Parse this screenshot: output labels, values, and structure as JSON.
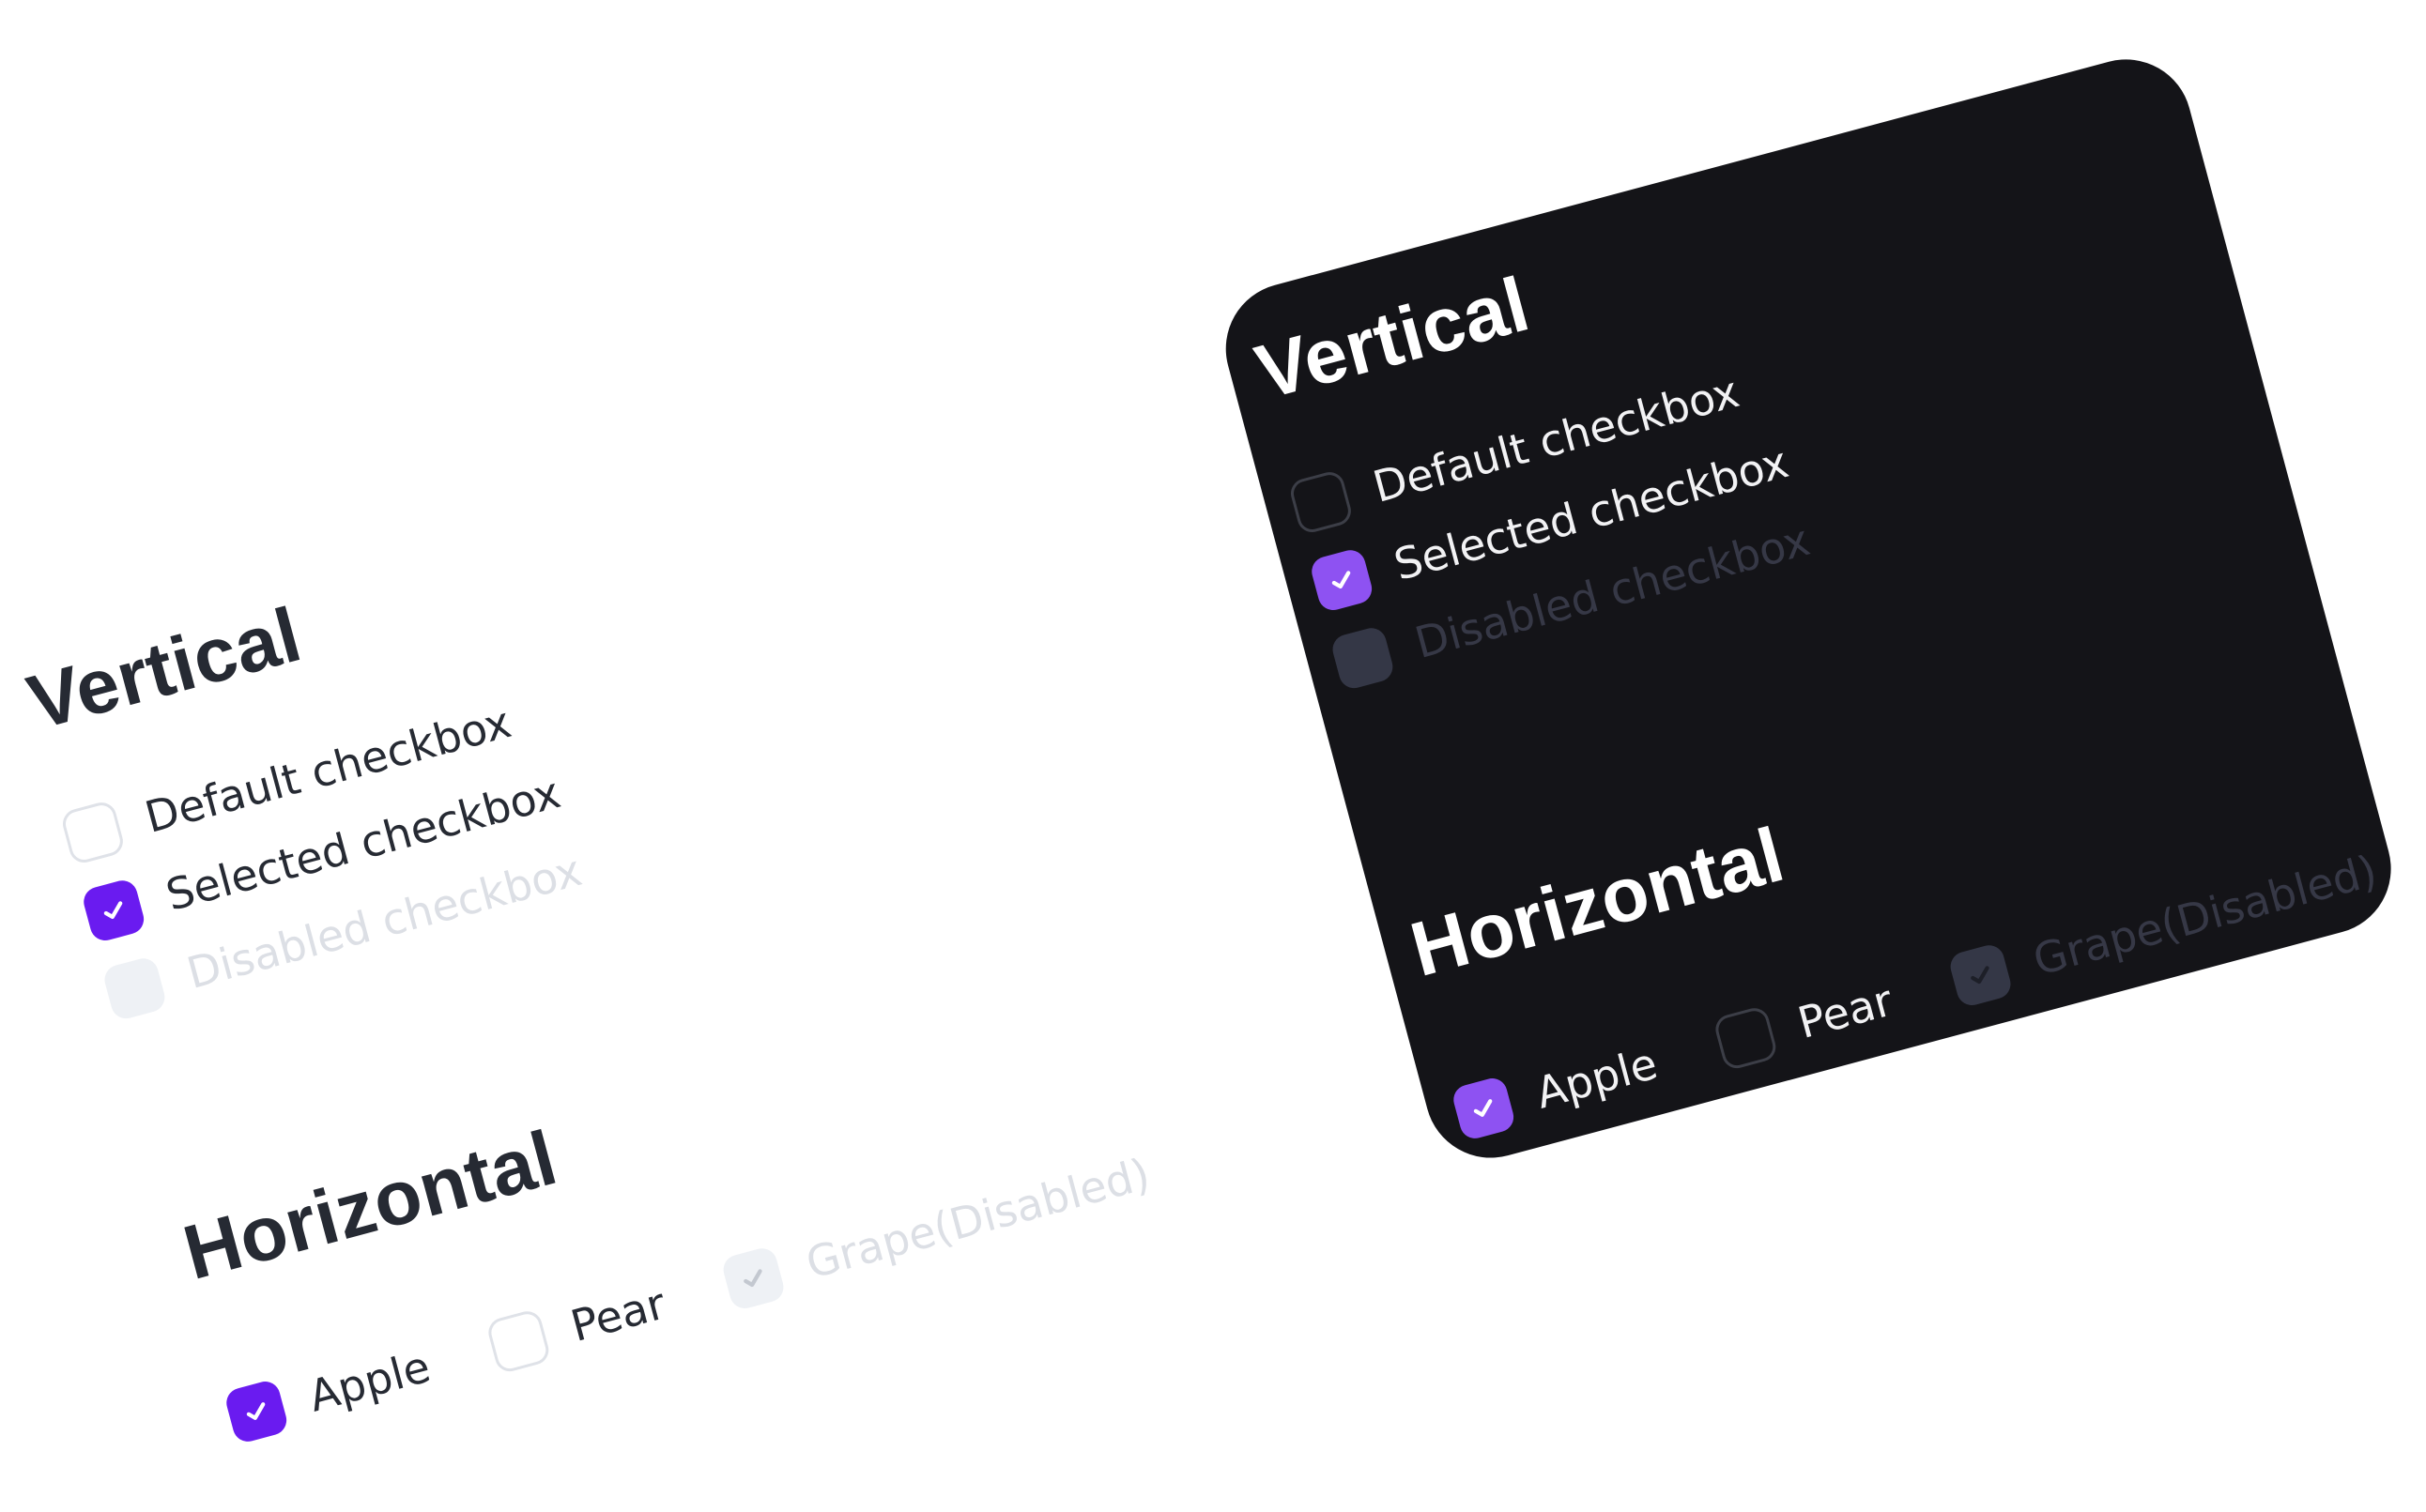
{
  "light_panel": {
    "vertical": {
      "heading": "Vertical",
      "items": [
        {
          "label": "Default checkbox",
          "state": "default"
        },
        {
          "label": "Selected checkbox",
          "state": "checked"
        },
        {
          "label": "Disabled checkbox",
          "state": "disabled"
        }
      ]
    },
    "horizontal": {
      "heading": "Horizontal",
      "items": [
        {
          "label": "Apple",
          "state": "checked"
        },
        {
          "label": "Pear",
          "state": "default"
        },
        {
          "label": "Grape(Disabled)",
          "state": "disabled-checked"
        }
      ]
    }
  },
  "dark_panel": {
    "vertical": {
      "heading": "Vertical",
      "items": [
        {
          "label": "Default checkbox",
          "state": "default"
        },
        {
          "label": "Selected checkbox",
          "state": "checked"
        },
        {
          "label": "Disabled checkbox",
          "state": "disabled"
        }
      ]
    },
    "horizontal": {
      "heading": "Horizontal",
      "items": [
        {
          "label": "Apple",
          "state": "checked"
        },
        {
          "label": "Pear",
          "state": "default"
        },
        {
          "label": "Grape(Disabled)",
          "state": "disabled-checked"
        }
      ]
    }
  },
  "colors": {
    "accent_light": "#6a1bf0",
    "accent_dark": "#8e52f2",
    "card_background": "#141418",
    "text_dark": "#262a33"
  },
  "icons": {
    "check": "checkmark-icon"
  }
}
